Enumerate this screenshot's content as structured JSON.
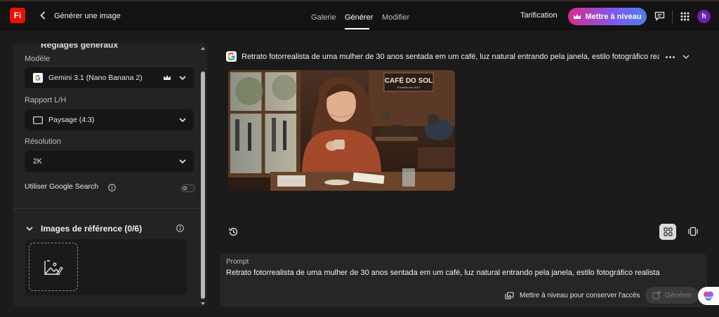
{
  "header": {
    "logo_text": "Fi",
    "title": "Générer une image",
    "tabs": [
      {
        "label": "Galerie",
        "active": false
      },
      {
        "label": "Générer",
        "active": true
      },
      {
        "label": "Modifier",
        "active": false
      }
    ],
    "pricing_label": "Tarification",
    "upgrade_label": "Mettre à niveau",
    "avatar_initial": "h"
  },
  "settings": {
    "section_heading": "Réglages généraux",
    "model_label": "Modèle",
    "model_value": "Gemini 3.1 (Nano Banana 2)",
    "ratio_label": "Rapport L/H",
    "ratio_value": "Paysage (4:3)",
    "resolution_label": "Résolution",
    "resolution_value": "2K",
    "google_search_label": "Utiliser Google Search",
    "google_search_enabled": false,
    "reference_title": "Images de référence (0/6)"
  },
  "result": {
    "prompt_heading": "Retrato fotorrealista de uma mulher de 30 anos sentada em um café, luz natural entrando pela janela, estilo fotográfico rea",
    "sign_title": "CAFÉ DO SOL",
    "sign_subtitle": "Fundado em 2012"
  },
  "prompt": {
    "label": "Prompt",
    "text": "Retrato fotorrealista de uma mulher de 30 anos sentada em um café, luz natural entrando pela janela, estilo fotográfico realista",
    "upsell_label": "Mettre à niveau pour conserver l'accès",
    "generate_label": "Générer"
  },
  "colors": {
    "brand_red": "#eb1000",
    "upgrade_gradient_start": "#d92c8c",
    "upgrade_gradient_end": "#4b7ff0",
    "avatar": "#6a1fb8"
  }
}
